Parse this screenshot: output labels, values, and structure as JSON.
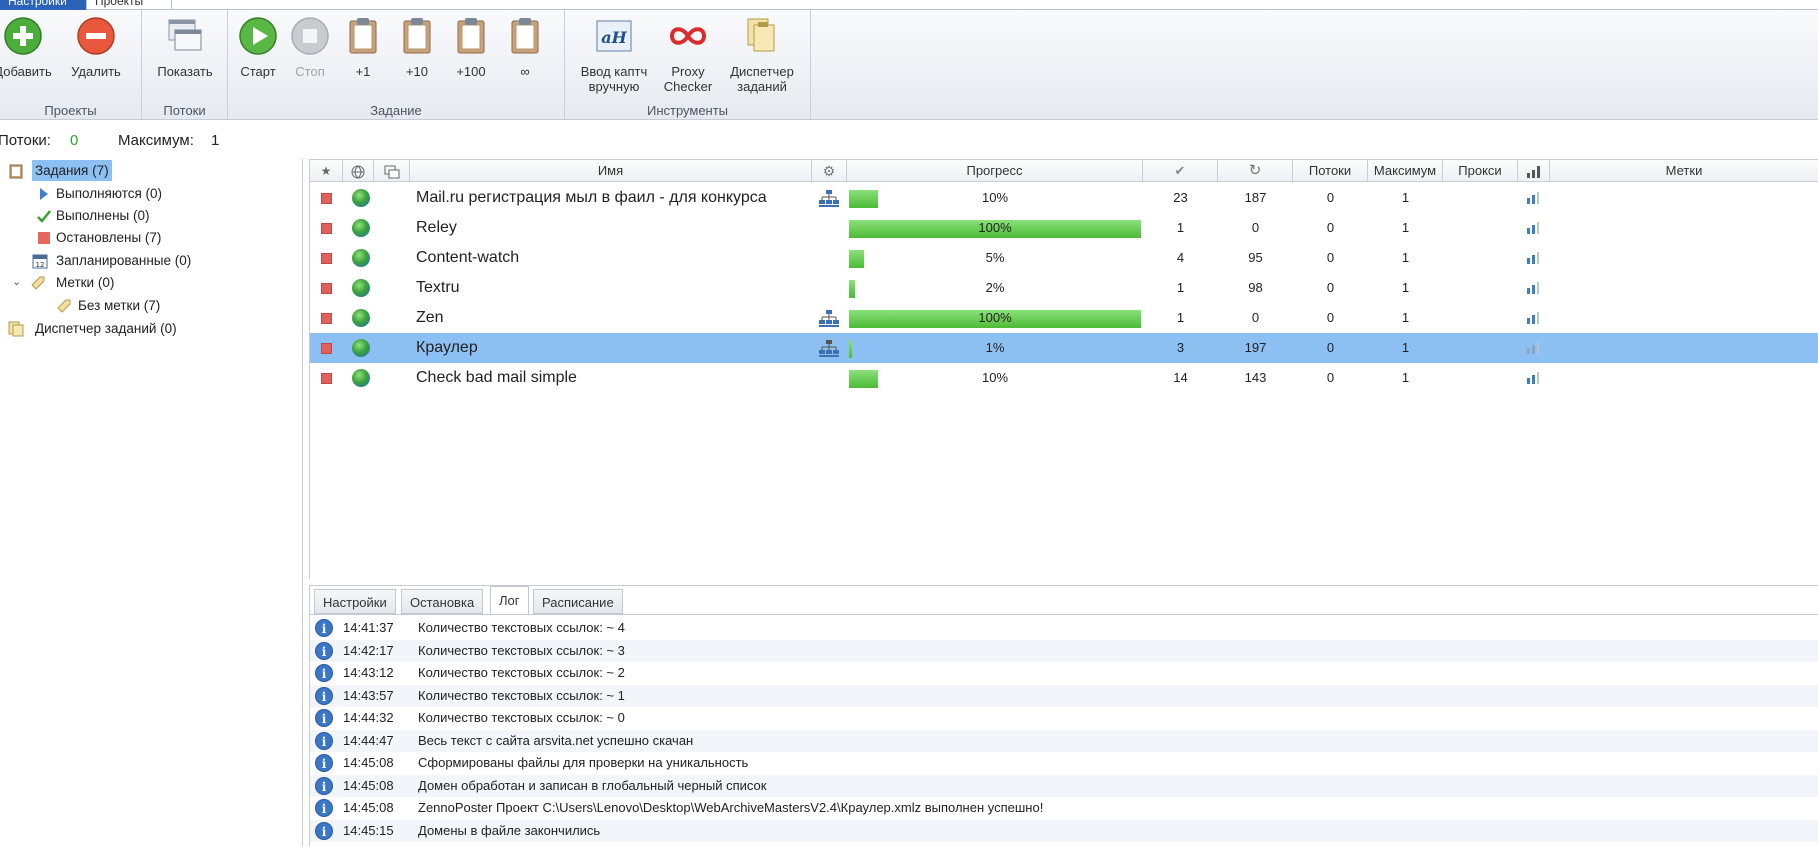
{
  "top_tabs": [
    "Настройки",
    "Проекты"
  ],
  "ribbon": {
    "groups": {
      "projects": {
        "title": "Проекты",
        "buttons": [
          "Добавить",
          "Удалить"
        ]
      },
      "threads": {
        "title": "Потоки",
        "buttons": [
          "Показать"
        ]
      },
      "task": {
        "title": "Задание",
        "buttons": [
          "Старт",
          "Стоп",
          "+1",
          "+10",
          "+100",
          "∞"
        ]
      },
      "tools": {
        "title": "Инструменты",
        "buttons": [
          "Ввод каптч вручную",
          "Proxy Checker",
          "Диспетчер заданий"
        ]
      }
    }
  },
  "status": {
    "threads_label": "Потоки:",
    "threads_value": "0",
    "max_label": "Максимум:",
    "max_value": "1"
  },
  "sidebar": {
    "items": [
      {
        "label": "Задания (7)",
        "icon": "clipboard-icon"
      },
      {
        "label": "Выполняются (0)",
        "icon": "play-arrow-icon"
      },
      {
        "label": "Выполнены (0)",
        "icon": "checkmark-icon"
      },
      {
        "label": "Остановлены (7)",
        "icon": "stop-square-icon"
      },
      {
        "label": "Запланированные (0)",
        "icon": "calendar-icon"
      },
      {
        "label": "Метки (0)",
        "icon": "tag-icon"
      },
      {
        "label": "Без метки (7)",
        "icon": "tag-icon"
      },
      {
        "label": "Диспетчер заданий (0)",
        "icon": "task-manager-icon"
      }
    ]
  },
  "grid": {
    "columns": {
      "name": "Имя",
      "progress": "Прогресс",
      "threads": "Потоки",
      "max": "Максимум",
      "proxy": "Прокси",
      "tags": "Метки"
    },
    "rows": [
      {
        "name": "Mail.ru регистрация мыл в фаил - для конкурса",
        "progress": "10%",
        "progress_fraction": 0.1,
        "done": "23",
        "retry": "187",
        "threads": "0",
        "max": "1",
        "network": true
      },
      {
        "name": "Releу",
        "progress": "100%",
        "progress_fraction": 1.0,
        "done": "1",
        "retry": "0",
        "threads": "0",
        "max": "1",
        "network": false
      },
      {
        "name": "Content-watch",
        "progress": "5%",
        "progress_fraction": 0.05,
        "done": "4",
        "retry": "95",
        "threads": "0",
        "max": "1",
        "network": false
      },
      {
        "name": "Textru",
        "progress": "2%",
        "progress_fraction": 0.02,
        "done": "1",
        "retry": "98",
        "threads": "0",
        "max": "1",
        "network": false
      },
      {
        "name": "Zen",
        "progress": "100%",
        "progress_fraction": 1.0,
        "done": "1",
        "retry": "0",
        "threads": "0",
        "max": "1",
        "network": true
      },
      {
        "name": "Краулер",
        "progress": "1%",
        "progress_fraction": 0.01,
        "done": "3",
        "retry": "197",
        "threads": "0",
        "max": "1",
        "network": true,
        "selected": true
      },
      {
        "name": "Check bad mail simple",
        "progress": "10%",
        "progress_fraction": 0.1,
        "done": "14",
        "retry": "143",
        "threads": "0",
        "max": "1",
        "network": false
      }
    ]
  },
  "bottom_tabs": [
    "Настройки",
    "Остановка",
    "Лог",
    "Расписание"
  ],
  "log": [
    {
      "time": "14:41:37",
      "msg": "Количество текстовых ссылок: ~ 4"
    },
    {
      "time": "14:42:17",
      "msg": "Количество текстовых ссылок: ~ 3"
    },
    {
      "time": "14:43:12",
      "msg": "Количество текстовых ссылок: ~ 2"
    },
    {
      "time": "14:43:57",
      "msg": "Количество текстовых ссылок: ~ 1"
    },
    {
      "time": "14:44:32",
      "msg": "Количество текстовых ссылок: ~ 0"
    },
    {
      "time": "14:44:47",
      "msg": "Весь текст с сайта arsvita.net успешно скачан"
    },
    {
      "time": "14:45:08",
      "msg": "Сформированы файлы для проверки на уникальность"
    },
    {
      "time": "14:45:08",
      "msg": "Домен обработан и записан в глобальный черный список"
    },
    {
      "time": "14:45:08",
      "msg": "ZennoPoster Проект C:\\Users\\Lenovo\\Desktop\\WebArchiveMastersV2.4\\Краулер.xmlz выполнен успешно!"
    },
    {
      "time": "14:45:15",
      "msg": "Домены в файле закончились"
    }
  ]
}
